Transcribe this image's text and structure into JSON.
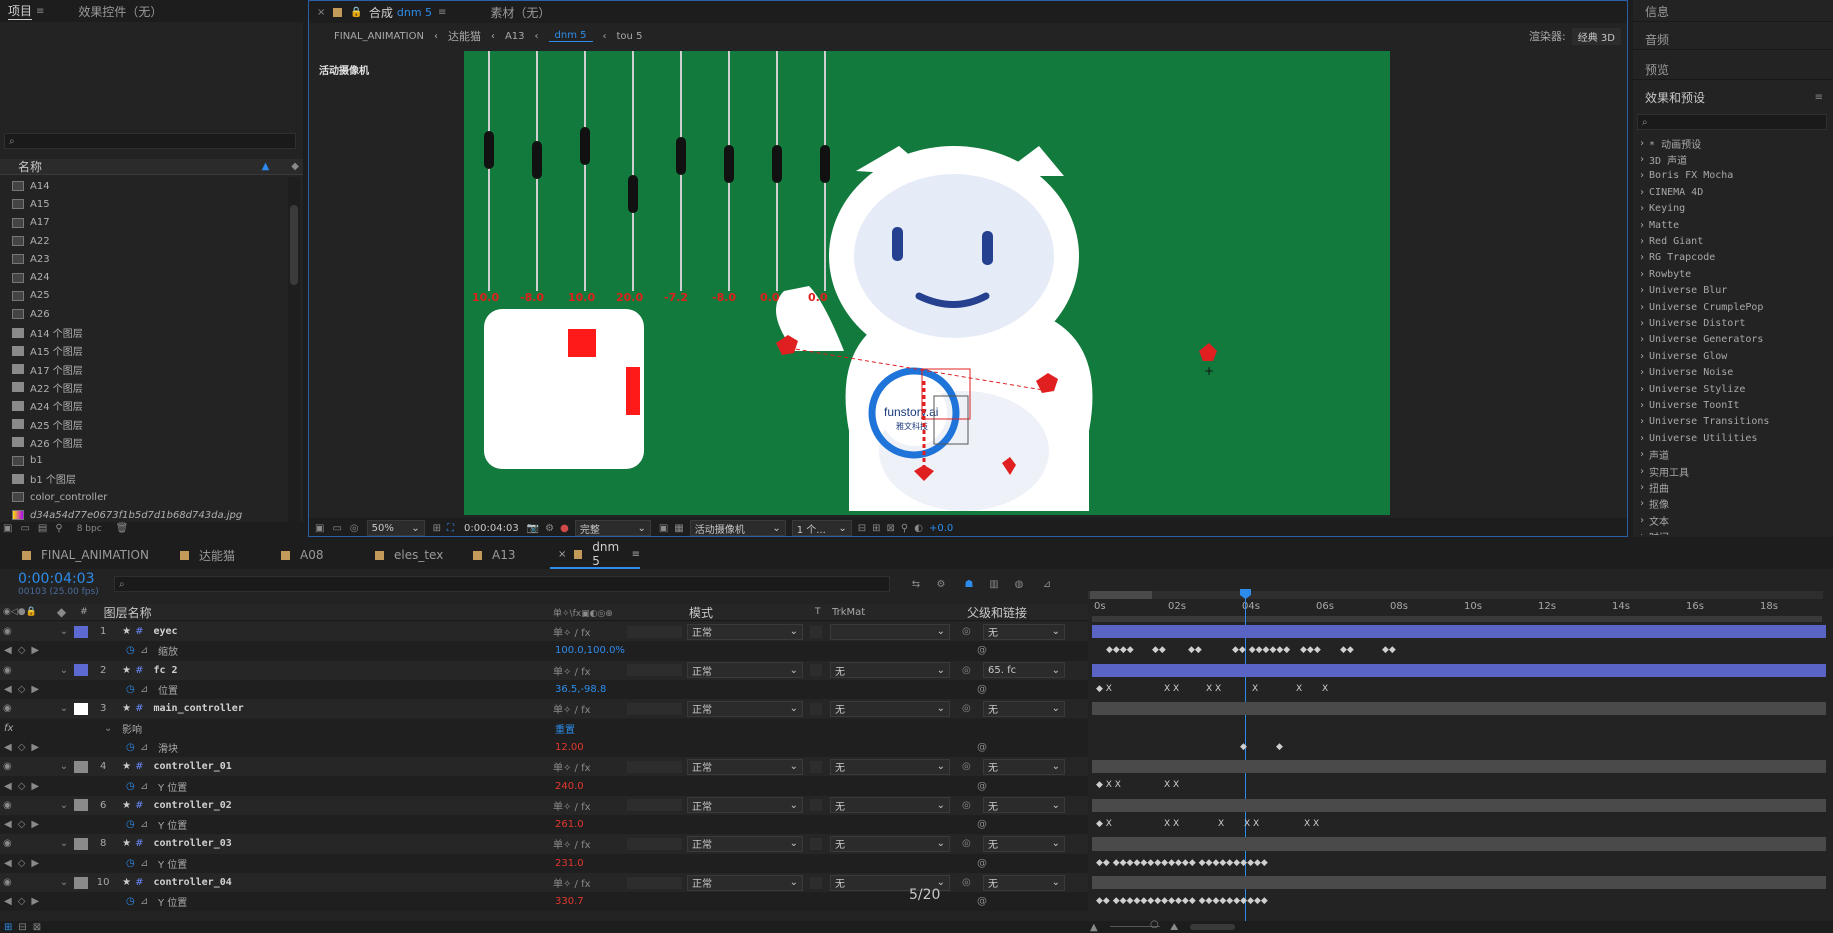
{
  "project_panel": {
    "tab_project": "项目",
    "tab_effect_controls": "效果控件（无）",
    "search_placeholder": "",
    "name_header": "名称",
    "items": [
      {
        "name": "A14",
        "type": "comp"
      },
      {
        "name": "A15",
        "type": "comp"
      },
      {
        "name": "A17",
        "type": "comp"
      },
      {
        "name": "A22",
        "type": "comp"
      },
      {
        "name": "A23",
        "type": "comp"
      },
      {
        "name": "A24",
        "type": "comp"
      },
      {
        "name": "A25",
        "type": "comp"
      },
      {
        "name": "A26",
        "type": "comp"
      },
      {
        "name": "A14 个图层",
        "type": "folder"
      },
      {
        "name": "A15 个图层",
        "type": "folder"
      },
      {
        "name": "A17 个图层",
        "type": "folder"
      },
      {
        "name": "A22 个图层",
        "type": "folder"
      },
      {
        "name": "A24 个图层",
        "type": "folder"
      },
      {
        "name": "A25 个图层",
        "type": "folder"
      },
      {
        "name": "A26 个图层",
        "type": "folder"
      },
      {
        "name": "b1",
        "type": "comp"
      },
      {
        "name": "b1 个图层",
        "type": "folder"
      },
      {
        "name": "color_controller",
        "type": "comp"
      },
      {
        "name": "d34a54d77e0673f1b5d7d1b68d743da.jpg",
        "type": "image"
      }
    ],
    "bpc": "8 bpc"
  },
  "comp_viewer": {
    "tab_label": "合成",
    "tab_comp": "dnm 5",
    "tab_footage": "素材（无）",
    "breadcrumbs": [
      "FINAL_ANIMATION",
      "达能猫",
      "A13",
      "dnm 5",
      "tou 5"
    ],
    "renderer_label": "渲染器:",
    "renderer_value": "经典 3D",
    "camera_label": "活动摄像机",
    "slider_values": [
      "10.0",
      "-8.0",
      "10.0",
      "20.0",
      "-7.2",
      "-8.0",
      "0.0",
      "0.0"
    ],
    "logo_text": "funstory.ai",
    "logo_sub": "雅文科技",
    "footer": {
      "zoom": "50%",
      "timecode": "0:00:04:03",
      "resolution": "完整",
      "view": "活动摄像机",
      "views_count": "1 个...",
      "exposure": "+0.0"
    },
    "colors": {
      "bg": "#137a3d",
      "red": "#ff0000",
      "white": "#ffffff"
    }
  },
  "right_panel": {
    "info": "信息",
    "audio": "音频",
    "preview": "预览",
    "effects_title": "效果和预设",
    "effects": [
      "* 动画预设",
      "3D 声道",
      "Boris FX Mocha",
      "CINEMA 4D",
      "Keying",
      "Matte",
      "Red Giant",
      "RG Trapcode",
      "Rowbyte",
      "Universe Blur",
      "Universe CrumplePop",
      "Universe Distort",
      "Universe Generators",
      "Universe Glow",
      "Universe Noise",
      "Universe Stylize",
      "Universe ToonIt",
      "Universe Transitions",
      "Universe Utilities",
      "声道",
      "实用工具",
      "扭曲",
      "抠像",
      "文本",
      "时间"
    ]
  },
  "timeline": {
    "tabs": [
      {
        "label": "FINAL_ANIMATION"
      },
      {
        "label": "达能猫"
      },
      {
        "label": "A08"
      },
      {
        "label": "eles_tex"
      },
      {
        "label": "A13"
      },
      {
        "label": "dnm 5"
      }
    ],
    "current_time": "0:00:04:03",
    "frame_info": "00103 (25.00 fps)",
    "headers": {
      "layer_name": "图层名称",
      "mode": "模式",
      "t": "T",
      "trkmat": "TrkMat",
      "parent": "父级和链接"
    },
    "ruler_ticks": [
      "0s",
      "02s",
      "04s",
      "06s",
      "08s",
      "10s",
      "12s",
      "14s",
      "16s",
      "18s"
    ],
    "layers": [
      {
        "kind": "layer",
        "num": "1",
        "name": "eyec",
        "color": "#5c6ad2",
        "mode": "正常",
        "trkmat": "",
        "parent": "无"
      },
      {
        "kind": "prop",
        "name": "缩放",
        "value": "100.0,100.0%",
        "value_color": "blue"
      },
      {
        "kind": "layer",
        "num": "2",
        "name": "fc 2",
        "color": "#5c6ad2",
        "mode": "正常",
        "trkmat": "无",
        "parent": "65. fc"
      },
      {
        "kind": "prop",
        "name": "位置",
        "value": "36.5,-98.8",
        "value_color": "blue"
      },
      {
        "kind": "layer",
        "num": "3",
        "name": "main_controller",
        "color": "#ffffff",
        "mode": "正常",
        "trkmat": "无",
        "parent": "无"
      },
      {
        "kind": "group",
        "name": "影响",
        "value": "重置",
        "value_color": "blue"
      },
      {
        "kind": "prop",
        "name": "滑块",
        "value": "12.00",
        "value_color": "red"
      },
      {
        "kind": "layer",
        "num": "4",
        "name": "controller_01",
        "color": "#8a8a8a",
        "mode": "正常",
        "trkmat": "无",
        "parent": "无"
      },
      {
        "kind": "prop",
        "name": "Y 位置",
        "value": "240.0",
        "value_color": "red"
      },
      {
        "kind": "layer",
        "num": "6",
        "name": "controller_02",
        "color": "#8a8a8a",
        "mode": "正常",
        "trkmat": "无",
        "parent": "无"
      },
      {
        "kind": "prop",
        "name": "Y 位置",
        "value": "261.0",
        "value_color": "red"
      },
      {
        "kind": "layer",
        "num": "8",
        "name": "controller_03",
        "color": "#8a8a8a",
        "mode": "正常",
        "trkmat": "无",
        "parent": "无"
      },
      {
        "kind": "prop",
        "name": "Y 位置",
        "value": "231.0",
        "value_color": "red"
      },
      {
        "kind": "layer",
        "num": "10",
        "name": "controller_04",
        "color": "#8a8a8a",
        "mode": "正常",
        "trkmat": "无",
        "parent": "无"
      },
      {
        "kind": "prop",
        "name": "Y 位置",
        "value": "330.7",
        "value_color": "red"
      }
    ],
    "page_indicator": "5/20"
  }
}
